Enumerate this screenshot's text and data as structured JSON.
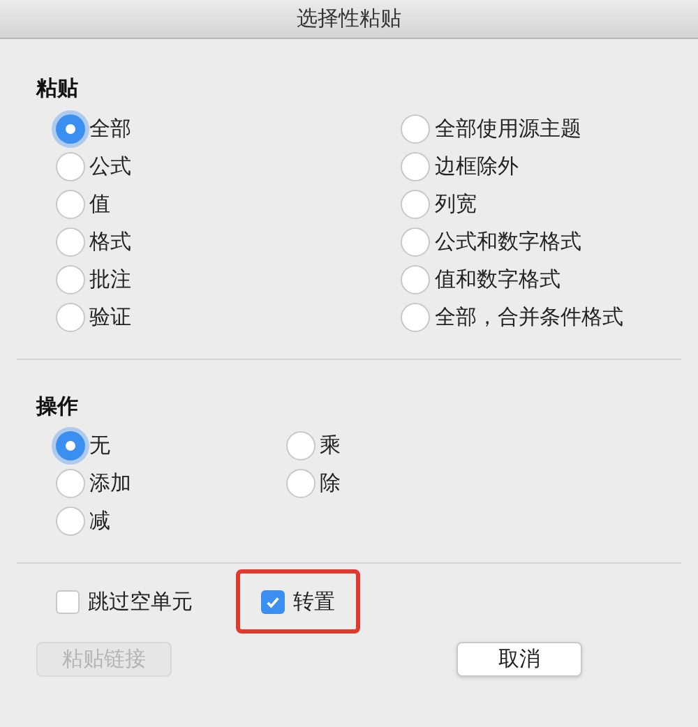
{
  "window": {
    "title": "选择性粘贴"
  },
  "paste": {
    "label": "粘贴",
    "columns": [
      [
        {
          "label": "全部",
          "selected": true
        },
        {
          "label": "公式",
          "selected": false
        },
        {
          "label": "值",
          "selected": false
        },
        {
          "label": "格式",
          "selected": false
        },
        {
          "label": "批注",
          "selected": false
        },
        {
          "label": "验证",
          "selected": false
        }
      ],
      [
        {
          "label": "全部使用源主题",
          "selected": false
        },
        {
          "label": "边框除外",
          "selected": false
        },
        {
          "label": "列宽",
          "selected": false
        },
        {
          "label": "公式和数字格式",
          "selected": false
        },
        {
          "label": "值和数字格式",
          "selected": false
        },
        {
          "label": "全部，合并条件格式",
          "selected": false
        }
      ]
    ]
  },
  "operation": {
    "label": "操作",
    "columns": [
      [
        {
          "label": "无",
          "selected": true
        },
        {
          "label": "添加",
          "selected": false
        },
        {
          "label": "减",
          "selected": false
        }
      ],
      [
        {
          "label": "乘",
          "selected": false
        },
        {
          "label": "除",
          "selected": false
        }
      ]
    ]
  },
  "checkboxes": [
    {
      "label": "跳过空单元",
      "checked": false,
      "highlighted": false
    },
    {
      "label": "转置",
      "checked": true,
      "highlighted": true
    }
  ],
  "buttons": [
    {
      "label": "粘贴链接",
      "disabled": true
    },
    {
      "label": "取消",
      "disabled": false
    }
  ]
}
